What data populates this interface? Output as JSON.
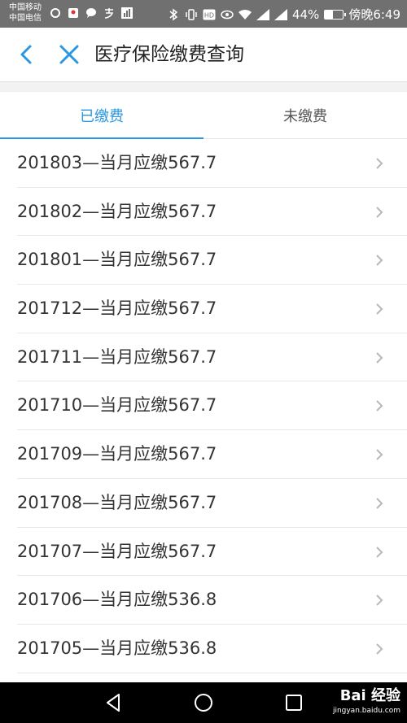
{
  "status_bar": {
    "carrier_1": "中国移动",
    "carrier_2": "中国电信",
    "battery_percent": "44%",
    "battery_level": 0.44,
    "time": "傍晚6:49"
  },
  "nav": {
    "title": "医疗保险缴费查询"
  },
  "tabs": [
    {
      "label": "已缴费",
      "active": true
    },
    {
      "label": "未缴费",
      "active": false
    }
  ],
  "records": [
    "201803—当月应缴567.7",
    "201802—当月应缴567.7",
    "201801—当月应缴567.7",
    "201712—当月应缴567.7",
    "201711—当月应缴567.7",
    "201710—当月应缴567.7",
    "201709—当月应缴567.7",
    "201708—当月应缴567.7",
    "201707—当月应缴567.7",
    "201706—当月应缴536.8",
    "201705—当月应缴536.8"
  ],
  "watermark": {
    "logo": "Bai 经验",
    "url": "jingyan.baidu.com"
  },
  "colors": {
    "accent": "#2a97e3",
    "status_bar": "#707070",
    "system_nav": "#000000"
  }
}
